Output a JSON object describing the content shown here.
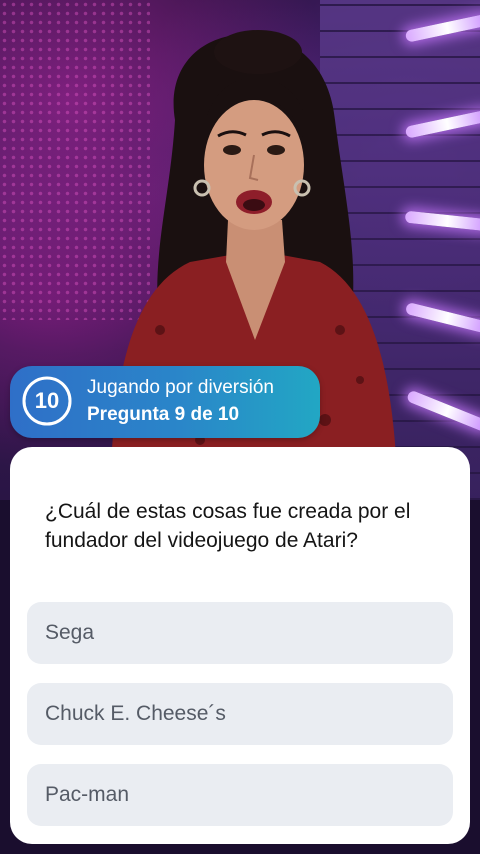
{
  "game_status": {
    "timer_value": "10",
    "mode_text": "Jugando por diversión",
    "progress_text": "Pregunta 9 de 10",
    "accent_gradient": [
      "#2f6fc8",
      "#22a7c4"
    ]
  },
  "question": {
    "text": "¿Cuál de estas cosas fue creada por el fundador del videojuego de Atari?"
  },
  "answers": [
    {
      "label": "Sega"
    },
    {
      "label": "Chuck E. Cheese´s"
    },
    {
      "label": "Pac-man"
    }
  ],
  "colors": {
    "card_background": "#ffffff",
    "answer_background": "#eaedf2",
    "answer_text": "#555b66",
    "question_text": "#151515"
  }
}
